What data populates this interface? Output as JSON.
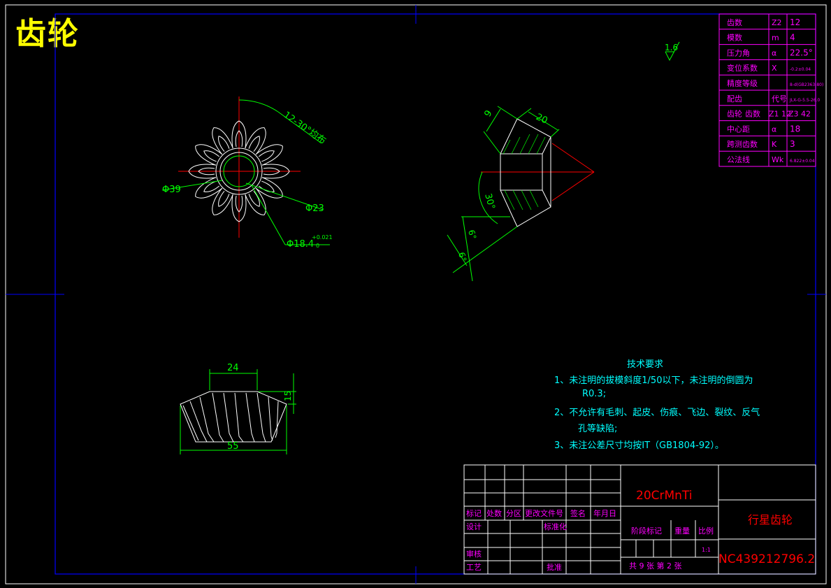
{
  "title": "齿轮",
  "colors": {
    "background": "#000000",
    "frame": "#0000ff",
    "outline": "#ffffff",
    "dimension": "#00ff00",
    "centerline": "#ff0000",
    "table": "#ff00ff",
    "title_text": "#ffff00",
    "notes": "#00ffff"
  },
  "surface_finish": "1.6",
  "gear_params": {
    "rows": [
      {
        "name": "齿数",
        "symbol": "Z2",
        "value": "12"
      },
      {
        "name": "模数",
        "symbol": "m",
        "value": "4"
      },
      {
        "name": "压力角",
        "symbol": "α",
        "value": "22.5°"
      },
      {
        "name": "变位系数",
        "symbol": "X",
        "value": "-0.2±0.04"
      },
      {
        "name": "精度等级",
        "symbol": "",
        "value": "8-d(GB2363-80)"
      },
      {
        "name": "配齿",
        "symbol": "代号",
        "value": "JLX-G-5.5-26.0"
      },
      {
        "name": "齿轮",
        "symbol": "齿数",
        "value": "Z1 12",
        "value2": "Z3 42"
      },
      {
        "name": "中心距",
        "symbol": "α",
        "value": "18"
      },
      {
        "name": "跨测齿数",
        "symbol": "K",
        "value": "3"
      },
      {
        "name": "公法线",
        "symbol": "Wk",
        "value": "6.822±0.04"
      }
    ]
  },
  "dimensions": {
    "front_view": {
      "spline": "12-30°均布",
      "outer_dia": "Φ39",
      "inner_dia": "Φ23",
      "bore_dia": "Φ18.4",
      "bore_tol": "+0.021",
      "bore_tol2": "0"
    },
    "side_view": {
      "d1": "9",
      "d2": "20",
      "d3": "30°",
      "d4": "6°",
      "d5": "6°"
    },
    "bottom_view": {
      "top_width": "24",
      "height": "15",
      "bottom_width": "55"
    }
  },
  "tech_notes": {
    "heading": "技术要求",
    "line1": "1、未注明的拔模斜度1/50以下，未注明的倒圆为",
    "line1b": "R0.3;",
    "line2": "2、不允许有毛刺、起皮、伤痕、飞边、裂纹、反气",
    "line2b": "孔等缺陷;",
    "line3": "3、未注公差尺寸均按IT（GB1804-92）。"
  },
  "title_block": {
    "material": "20CrMnTi",
    "part_name": "行星齿轮",
    "drawing_no": "NC439212796.2",
    "labels": {
      "mark": "标记",
      "count": "处数",
      "zone": "分区",
      "change_doc": "更改文件号",
      "sign": "签名",
      "date": "年月日",
      "design": "设计",
      "standard": "标准化",
      "stage": "阶段标记",
      "weight": "重量",
      "scale": "比例",
      "review": "审核",
      "process": "工艺",
      "approve": "批准",
      "sheets": "共 9 张  第 2 张"
    },
    "scale_value": "1:1"
  }
}
